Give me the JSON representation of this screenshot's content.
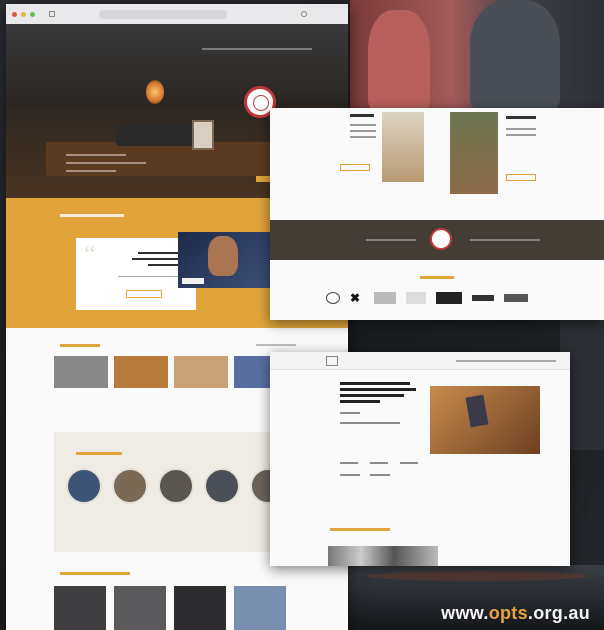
{
  "url": {
    "prefix": "www.",
    "accent": "opts",
    "suffix": ".org.au"
  },
  "colors": {
    "accent": "#e0a43a",
    "seal": "#c0383c",
    "dark_band": "#433d35"
  },
  "window_controls": [
    "close",
    "minimize",
    "maximize"
  ],
  "icons": [
    "seal-logo",
    "quote-mark",
    "video-thumbnail"
  ]
}
